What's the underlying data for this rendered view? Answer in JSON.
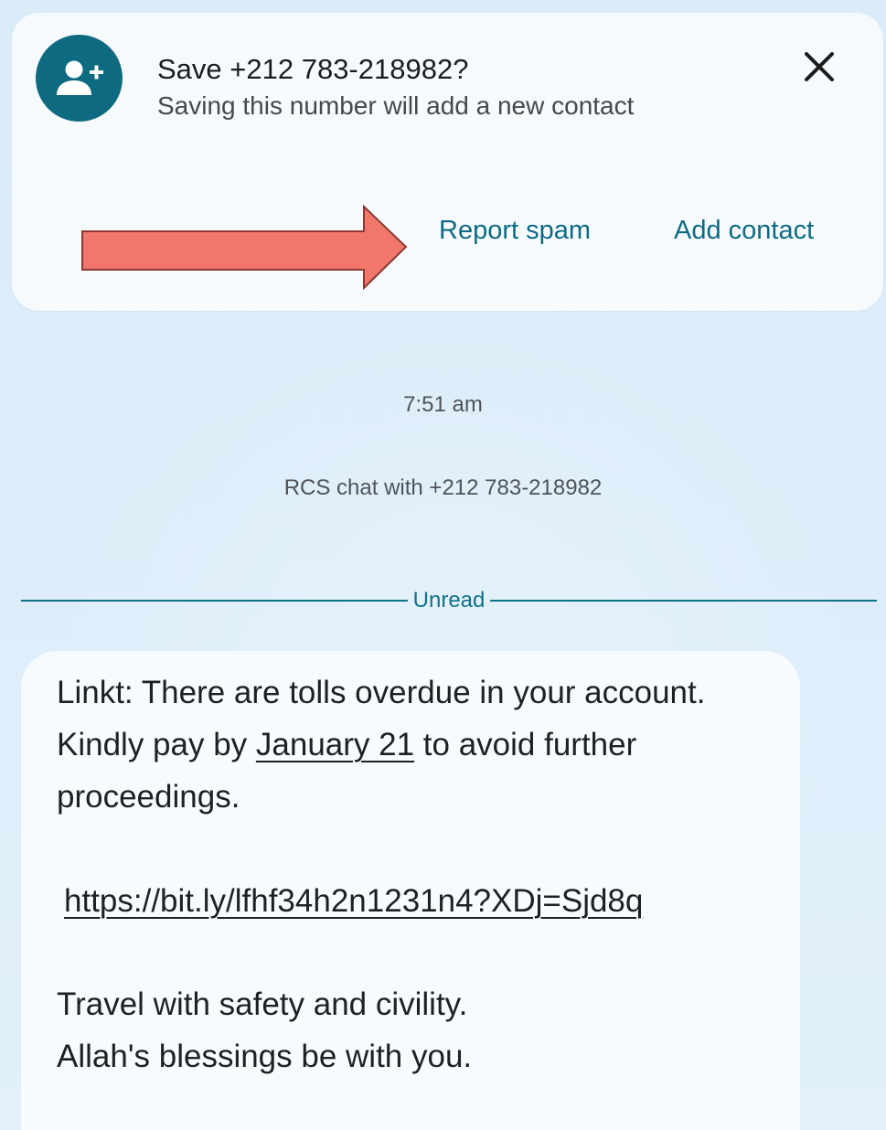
{
  "contact_prompt": {
    "title": "Save +212 783-218982?",
    "subtitle": "Saving this number will add a new contact",
    "icon": "add-person-icon",
    "close_icon": "close-icon",
    "actions": {
      "report_spam": "Report spam",
      "add_contact": "Add contact"
    },
    "annotation_arrow_color": "#f07769"
  },
  "conversation": {
    "timestamp": "7:51 am",
    "rcs_info": "RCS chat with +212 783-218982",
    "unread_label": "Unread",
    "message": {
      "line1": "Linkt: There are tolls overdue in your account.",
      "line2_before": "Kindly pay by ",
      "line2_date": "January 21",
      "line2_after": " to avoid further",
      "line3": "proceedings.",
      "link": "https://bit.ly/lfhf34h2n1231n4?XDj=Sjd8q",
      "line5": "Travel with safety and civility.",
      "line6": "Allah's blessings be with you."
    }
  },
  "colors": {
    "accent": "#0d6b84",
    "avatar_bg": "#0e6a80",
    "background": "#dcedf9",
    "card_bg": "#f7fafd"
  }
}
